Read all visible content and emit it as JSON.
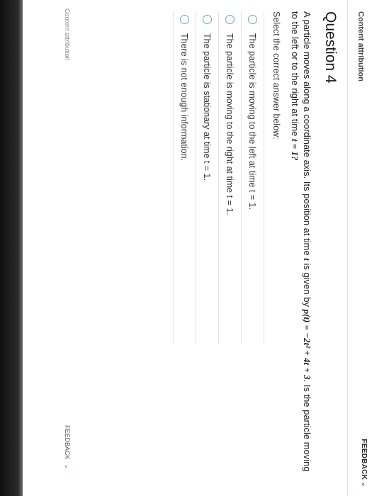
{
  "header": {
    "attribution": "Content attribution",
    "feedback": "FEEDBACK",
    "feedback_chevron": "⌄"
  },
  "question": {
    "title": "Question 4",
    "text_before": "A particle moves along a coordinate axis. Its position at time ",
    "t1": "t",
    "text_mid": " is given by ",
    "formula": "p(t) = −2t² + 4t + 3",
    "text_after": ". Is the particle moving to the left or to the right at time ",
    "t_eq": "t = 1",
    "qmark": "?"
  },
  "prompt": "Select the correct answer below:",
  "options": [
    {
      "label": "The particle is moving to the left at time t = 1."
    },
    {
      "label": "The particle is moving to the right at time t = 1."
    },
    {
      "label": "The particle is stationary at time t = 1."
    },
    {
      "label": "There is not enough information."
    }
  ],
  "footer": {
    "attribution": "Content attribution",
    "feedback": "FEEDBACK",
    "feedback_chevron": "⌄"
  },
  "colors": {
    "radio": "#6ba2c8",
    "chevron": "#3a6fb0"
  }
}
